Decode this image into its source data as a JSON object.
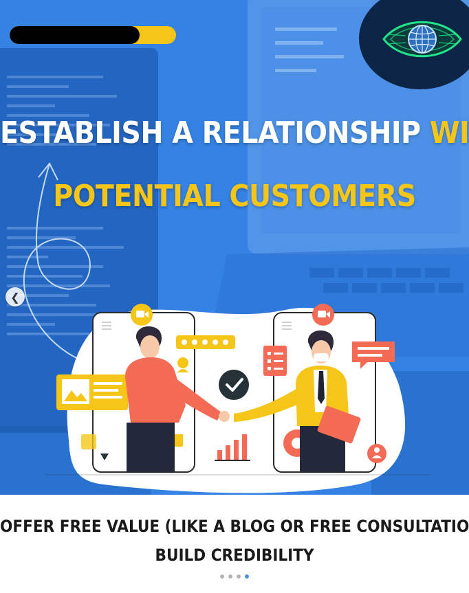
{
  "post": {
    "headline_part1": "ESTABLISH A RELATIONSHIP",
    "headline_part2": "WITH",
    "headline_line2": "POTENTIAL CUSTOMERS",
    "caption_line1": "OFFER FREE VALUE (LIKE A BLOG OR FREE CONSULTATIONS) TO",
    "caption_line2": "BUILD CREDIBILITY"
  },
  "progress": {
    "value": 0.78
  },
  "carousel": {
    "dot_count": 4,
    "active_index": 3,
    "prev_icon": "chevron-left-icon"
  },
  "colors": {
    "brand_blue": "#2f7fe0",
    "accent_yellow": "#f5c518",
    "logo_bg": "#0c2547",
    "logo_eye": "#20e38a"
  }
}
